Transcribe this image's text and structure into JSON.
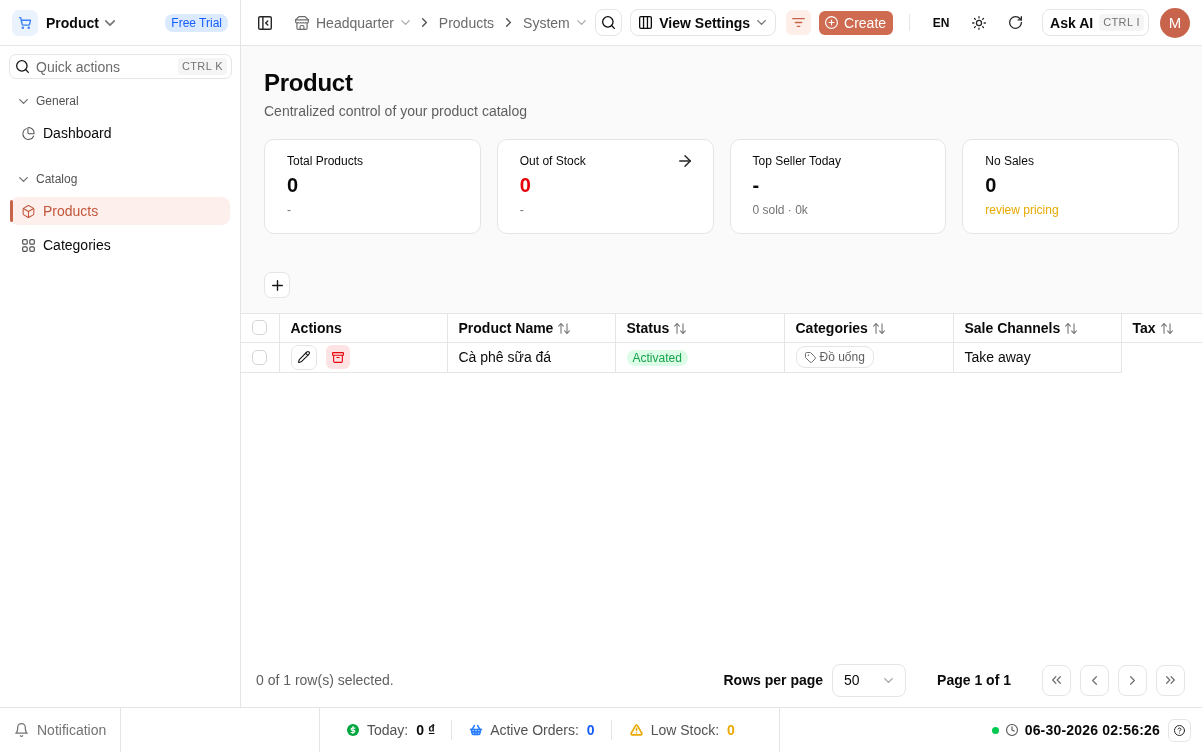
{
  "sidebar": {
    "app": {
      "title": "Product",
      "badge": "Free Trial"
    },
    "quick_actions": {
      "placeholder": "Quick actions",
      "shortcut": "CTRL K"
    },
    "groups": [
      {
        "label": "General",
        "expanded": true,
        "items": [
          {
            "label": "Dashboard",
            "selected": false
          }
        ]
      },
      {
        "label": "Catalog",
        "expanded": true,
        "items": [
          {
            "label": "Products",
            "selected": true
          },
          {
            "label": "Categories",
            "selected": false
          }
        ]
      }
    ]
  },
  "topbar": {
    "breadcrumb": [
      {
        "label": "Headquarter",
        "dropdown": true
      },
      {
        "label": "Products",
        "dropdown": false
      },
      {
        "label": "System",
        "dropdown": true
      }
    ],
    "view_settings": "View Settings",
    "filter_active": true,
    "create": "Create",
    "language": "EN",
    "ask_ai": {
      "label": "Ask AI",
      "shortcut": "CTRL I"
    },
    "avatar": "M"
  },
  "page": {
    "title": "Product",
    "subtitle": "Centralized control of your product catalog"
  },
  "cards": [
    {
      "label": "Total Products",
      "value": "0",
      "note": "-",
      "link": false,
      "kind": "plain"
    },
    {
      "label": "Out of Stock",
      "value": "0",
      "note": "-",
      "link": true,
      "kind": "danger"
    },
    {
      "label": "Top Seller Today",
      "value": "-",
      "note": "0 sold · 0k",
      "link": false,
      "kind": "plain"
    },
    {
      "label": "No Sales",
      "value": "0",
      "note": "review pricing",
      "link": false,
      "kind": "warning"
    }
  ],
  "table": {
    "select_all": {
      "checked": false
    },
    "columns": [
      {
        "label": "Actions",
        "sortable": false
      },
      {
        "label": "Product Name",
        "sortable": true
      },
      {
        "label": "Status",
        "sortable": true
      },
      {
        "label": "Categories",
        "sortable": true
      },
      {
        "label": "Sale Channels",
        "sortable": true
      },
      {
        "label": "Tax",
        "sortable": true
      }
    ],
    "rows": [
      {
        "selected": false,
        "product_name": "Cà phê sữa đá",
        "status": {
          "label": "Activated",
          "kind": "active"
        },
        "categories": [
          "Đồ uống"
        ],
        "sale_channels": "Take away"
      }
    ]
  },
  "footer": {
    "selection": "0 of 1 row(s) selected.",
    "rows_per_page": {
      "label": "Rows per page",
      "value": "50"
    },
    "page": "Page 1 of 1"
  },
  "status_bar": {
    "notification": "Notification",
    "stats": [
      {
        "label": "Today:",
        "color": "#00a63e",
        "value": {
          "text": "0 ₫",
          "color": "#0a0a0a"
        }
      },
      {
        "label": "Active Orders:",
        "color": "#2b7fff",
        "value": {
          "text": "0",
          "color": "#155dfc"
        }
      },
      {
        "label": "Low Stock:",
        "color": "#e8a900",
        "value": {
          "text": "0",
          "color": "#e8a900"
        }
      }
    ],
    "online": true,
    "datetime": "06-30-2026 02:56:26"
  }
}
